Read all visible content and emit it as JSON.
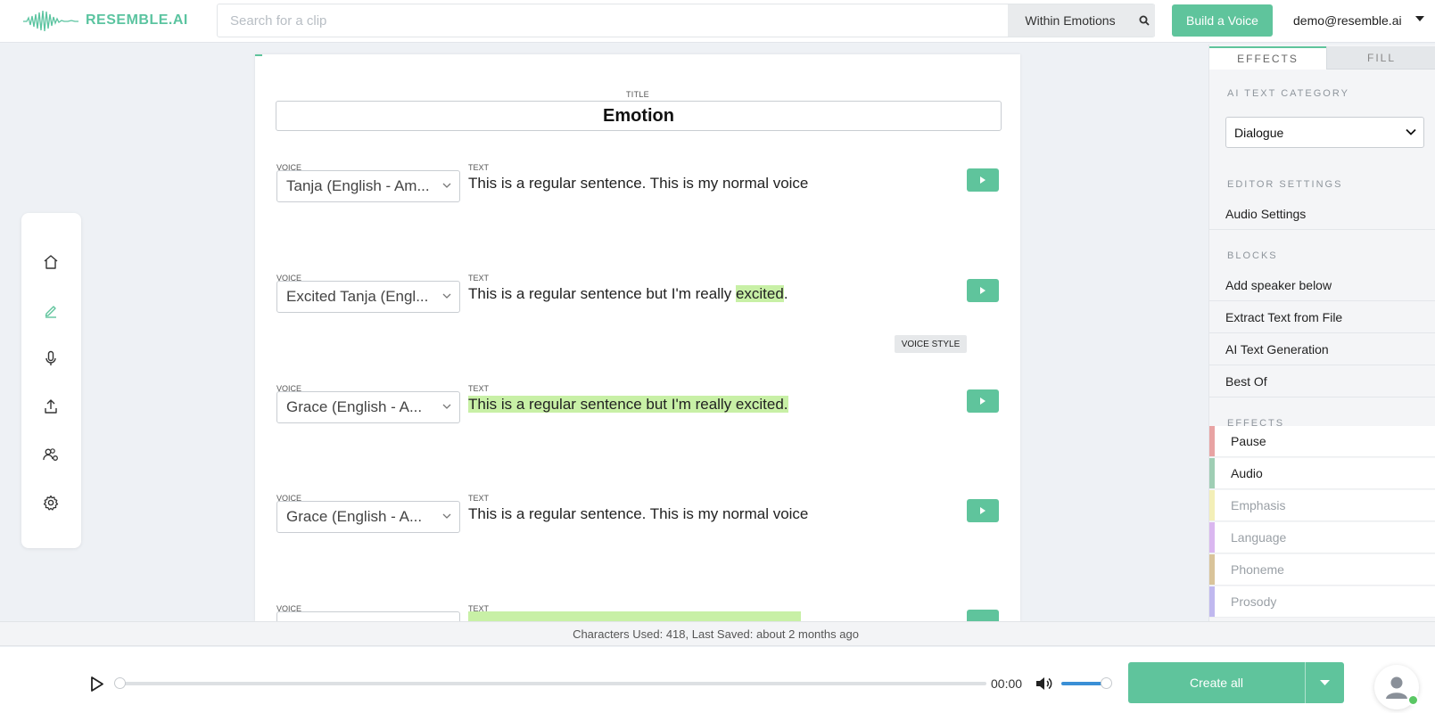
{
  "header": {
    "logo_text": "RESEMBLE.AI",
    "search_placeholder": "Search for a clip",
    "search_scope": "Within Emotions",
    "build_voice": "Build a Voice",
    "user_email": "demo@resemble.ai"
  },
  "nav": {
    "items": [
      "home-icon",
      "edit-icon",
      "microphone-icon",
      "upload-icon",
      "users-settings-icon",
      "gear-icon"
    ]
  },
  "editor": {
    "title_label": "TITLE",
    "title": "Emotion",
    "voice_label": "VOICE",
    "text_label": "TEXT",
    "voice_style_tag": "VOICE STYLE",
    "blocks": [
      {
        "voice": "Tanja (English - Am...",
        "text_before": "This is a regular sentence. This is my normal voice",
        "text_hl": "",
        "text_after": ""
      },
      {
        "voice": "Excited Tanja (Engl...",
        "text_before": "This is a regular sentence but I'm really ",
        "text_hl": "excited",
        "text_after": "."
      },
      {
        "voice": "Grace (English - A...",
        "text_before": "",
        "text_hl": "This is a regular sentence but I'm really excited.",
        "text_after": ""
      },
      {
        "voice": "Grace (English - A...",
        "text_before": "This is a regular sentence. This is my normal voice",
        "text_hl": "",
        "text_after": ""
      },
      {
        "voice": "",
        "text_before": "",
        "text_hl": "",
        "text_after": ""
      }
    ]
  },
  "status": {
    "text": "Characters Used: 418, Last Saved: about 2 months ago"
  },
  "sidebar": {
    "tab_effects": "EFFECTS",
    "tab_fill": "FILL",
    "ai_text_category_label": "AI TEXT CATEGORY",
    "ai_text_category_value": "Dialogue",
    "editor_settings_label": "EDITOR SETTINGS",
    "audio_settings": "Audio Settings",
    "blocks_label": "BLOCKS",
    "blocks_items": [
      "Add speaker below",
      "Extract Text from File",
      "AI Text Generation",
      "Best Of"
    ],
    "effects_label": "EFFECTS",
    "effects_items": [
      {
        "label": "Pause",
        "color": "#e8a3a3",
        "enabled": true
      },
      {
        "label": "Audio",
        "color": "#9fceb4",
        "enabled": true
      },
      {
        "label": "Emphasis",
        "color": "#f3efb7",
        "enabled": false
      },
      {
        "label": "Language",
        "color": "#dab7f0",
        "enabled": false
      },
      {
        "label": "Phoneme",
        "color": "#d9c49a",
        "enabled": false
      },
      {
        "label": "Prosody",
        "color": "#c0b8ef",
        "enabled": false
      }
    ]
  },
  "player": {
    "time": "00:00",
    "create_all": "Create all",
    "progress": 0,
    "volume": 0.9
  },
  "colors": {
    "accent": "#5fc49c",
    "highlight": "#c8f0a6"
  }
}
